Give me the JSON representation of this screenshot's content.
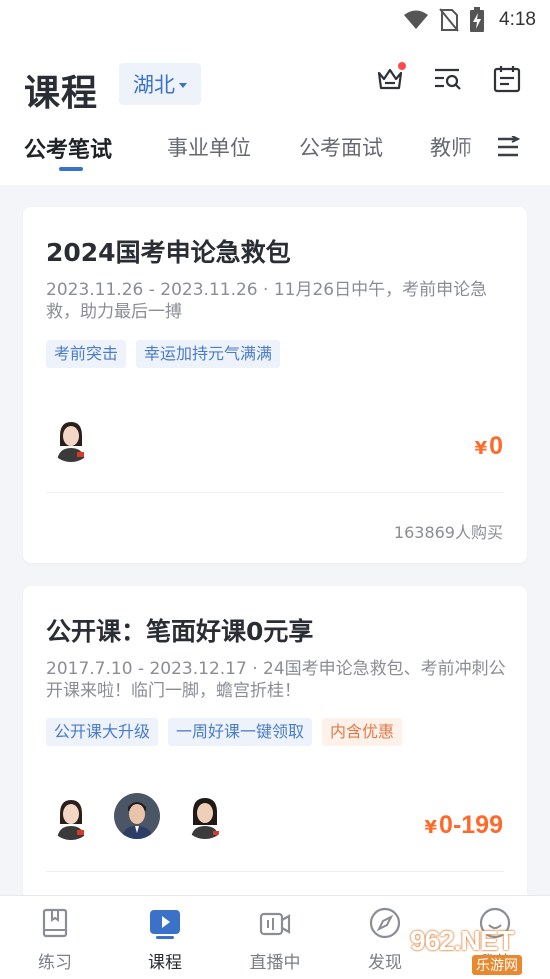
{
  "status_bar": {
    "time": "4:18"
  },
  "header": {
    "title": "课程",
    "region": "湖北"
  },
  "tabs": [
    {
      "label": "公考笔试",
      "active": true
    },
    {
      "label": "事业单位",
      "active": false
    },
    {
      "label": "公考面试",
      "active": false
    },
    {
      "label": "教师",
      "active": false
    }
  ],
  "courses": [
    {
      "title": "2024国考申论急救包",
      "description": "2023.11.26 - 2023.11.26 · 11月26日中午，考前申论急救，助力最后一搏",
      "tags": [
        {
          "label": "考前突击",
          "style": "normal"
        },
        {
          "label": "幸运加持元气满满",
          "style": "normal"
        }
      ],
      "price_symbol": "¥",
      "price": "0",
      "buyers": "163869人购买"
    },
    {
      "title": "公开课：笔面好课0元享",
      "description": "2017.7.10 - 2023.12.17 · 24国考申论急救包、考前冲刺公开课来啦！临门一脚，蟾宫折桂！",
      "tags": [
        {
          "label": "公开课大升级",
          "style": "normal"
        },
        {
          "label": "一周好课一键领取",
          "style": "normal"
        },
        {
          "label": "内含优惠",
          "style": "warn"
        }
      ],
      "price_symbol": "¥",
      "price": "0-199"
    }
  ],
  "bottom_nav": [
    {
      "label": "练习",
      "icon": "book-icon",
      "active": false
    },
    {
      "label": "课程",
      "icon": "play-icon",
      "active": true
    },
    {
      "label": "直播中",
      "icon": "live-camera-icon",
      "active": false
    },
    {
      "label": "发现",
      "icon": "compass-icon",
      "active": false
    },
    {
      "label": "我的",
      "icon": "profile-icon",
      "active": false
    }
  ],
  "watermark": {
    "text": "962.NET",
    "sub": "乐游网"
  },
  "colors": {
    "accent": "#3b72c9",
    "price": "#ff6a2b",
    "tag_bg": "#eef3fb",
    "warn_tag_text": "#e07a4a"
  }
}
